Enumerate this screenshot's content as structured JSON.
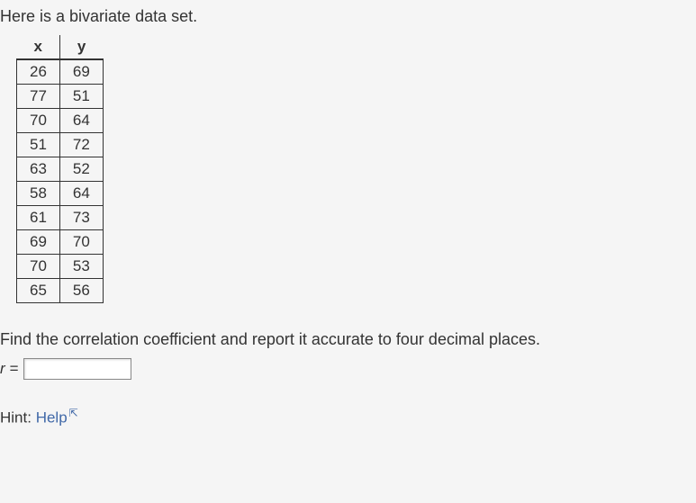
{
  "intro": "Here is a bivariate data set.",
  "table": {
    "headers": {
      "x": "x",
      "y": "y"
    },
    "rows": [
      {
        "x": "26",
        "y": "69"
      },
      {
        "x": "77",
        "y": "51"
      },
      {
        "x": "70",
        "y": "64"
      },
      {
        "x": "51",
        "y": "72"
      },
      {
        "x": "63",
        "y": "52"
      },
      {
        "x": "58",
        "y": "64"
      },
      {
        "x": "61",
        "y": "73"
      },
      {
        "x": "69",
        "y": "70"
      },
      {
        "x": "70",
        "y": "53"
      },
      {
        "x": "65",
        "y": "56"
      }
    ]
  },
  "question": "Find the correlation coefficient and report it accurate to four decimal places.",
  "answer": {
    "label": "r =",
    "value": ""
  },
  "hint": {
    "label": "Hint: ",
    "link_text": "Help"
  }
}
